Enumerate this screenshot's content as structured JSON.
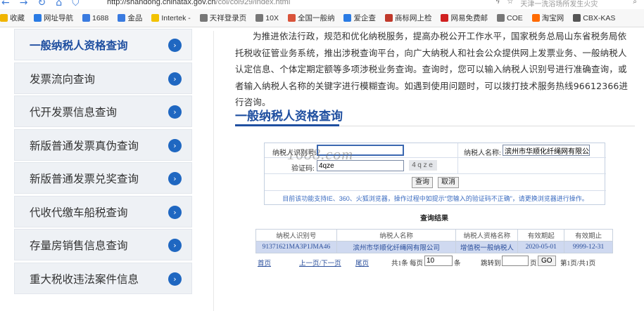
{
  "browser": {
    "url_host": "http://shandong.chinatax.gov.cn",
    "url_path": "/col/col929/index.html",
    "search_placeholder": "天津一洗浴场所发生火灾"
  },
  "bookmarks": [
    {
      "label": "收藏",
      "color": "#f0b400"
    },
    {
      "label": "网址导航",
      "color": "#2a7be4"
    },
    {
      "label": "1688",
      "color": "#3a7be0"
    },
    {
      "label": "金品",
      "color": "#3a7be0"
    },
    {
      "label": "Intertek -",
      "color": "#f2c200"
    },
    {
      "label": "天祥登录页",
      "color": "#777777"
    },
    {
      "label": "10X",
      "color": "#777777"
    },
    {
      "label": "全国一般纳",
      "color": "#d9533a"
    },
    {
      "label": "爱企查",
      "color": "#2a7be4"
    },
    {
      "label": "商标网上检",
      "color": "#c0392b"
    },
    {
      "label": "网易免费邮",
      "color": "#d02020"
    },
    {
      "label": "COE",
      "color": "#777777"
    },
    {
      "label": "淘宝网",
      "color": "#ff6a00"
    },
    {
      "label": "CBX-KAS",
      "color": "#555555"
    }
  ],
  "sidebar": {
    "items": [
      {
        "label": "一般纳税人资格查询"
      },
      {
        "label": "发票流向查询"
      },
      {
        "label": "代开发票信息查询"
      },
      {
        "label": "新版普通发票真伪查询"
      },
      {
        "label": "新版普通发票兑奖查询"
      },
      {
        "label": "代收代缴车船税查询"
      },
      {
        "label": "存量房销售信息查询"
      },
      {
        "label": "重大税收违法案件信息"
      }
    ]
  },
  "main": {
    "intro": "为推进依法行政，规范和优化纳税服务，提高办税公开工作水平，国家税务总局山东省税务局依托税收征管业务系统，推出涉税查询平台，向广大纳税人和社会公众提供网上发票业务、一般纳税人认定信息、个体定期定额等多项涉税业务查询。查询时，您可以输入纳税人识别号进行准确查询，或者输入纳税人名称的关键字进行模糊查询。如遇到使用问题时，可以拨打技术服务热线96612366进行咨询。",
    "section_title": "一般纳税人资格查询"
  },
  "form": {
    "taxpayer_id_label": "纳税人识别号:",
    "taxpayer_id_value": "",
    "taxpayer_name_label": "纳税人名称:",
    "taxpayer_name_value": "滨州市华顺化纤绳网有限公司",
    "captcha_label": "验证码:",
    "captcha_value": "4qze",
    "captcha_image_text": "4qze",
    "query_button": "查询",
    "cancel_button": "取消",
    "notice": "目前该功能支持IE、360、火狐浏览器，操作过程中如提示“您输入的验证码不正确”，请更换浏览器进行操作。",
    "watermark": "1688.com"
  },
  "results": {
    "title": "查询结果",
    "columns": [
      "纳税人识别号",
      "纳税人名称",
      "纳税人资格名称",
      "有效期起",
      "有效期止"
    ],
    "rows": [
      [
        "91371621MA3P1JMA46",
        "滨州市华顺化纤绳网有限公司",
        "增值税一般纳税人",
        "2020-05-01",
        "9999-12-31"
      ]
    ]
  },
  "pager": {
    "first": "首页",
    "prev_next": "上一页/下一页",
    "last": "尾页",
    "total": "共1条",
    "per_page_label": "每页",
    "per_page_value": "10",
    "unit": "条",
    "goto_label": "跳转到",
    "goto_value": "",
    "page_unit": "页",
    "go_button": "GO",
    "page_status": "第1页/共1页"
  }
}
